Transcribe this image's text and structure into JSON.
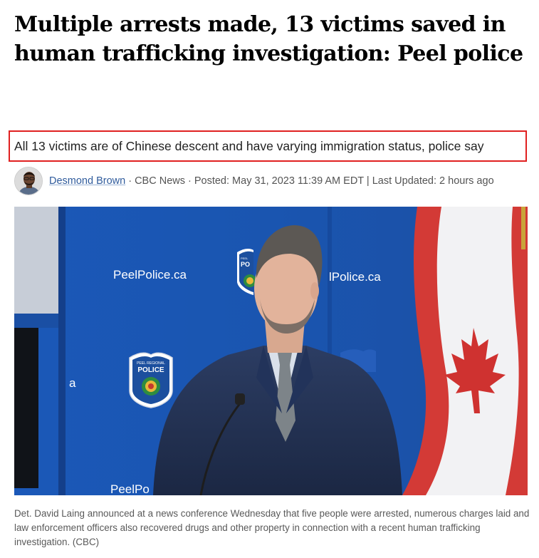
{
  "article": {
    "headline": "Multiple arrests made, 13 victims saved in human trafficking investigation: Peel police",
    "deck": "All 13 victims are of Chinese descent and have varying immigration status, police say",
    "byline": {
      "author": "Desmond Brown",
      "meta": " · CBC News · Posted: May 31, 2023 11:39 AM EDT | Last Updated: 2 hours ago"
    },
    "photo": {
      "backdrop_text_left": "PeelPolice.ca",
      "backdrop_text_right": "lPolice.ca",
      "backdrop_text_bottom": "PeelPo",
      "badge_top": "PEEL REGIONAL",
      "badge_main": "POLICE",
      "badge_small_top": "PEEL",
      "badge_small_main": "PO",
      "edge_letter": "a"
    },
    "caption": "Det. David Laing announced at a news conference Wednesday that five people were arrested, numerous charges laid and law enforcement officers also recovered drugs and other property in connection with a recent human trafficking investigation. (CBC)"
  },
  "colors": {
    "highlight_border": "#e02020",
    "author_link": "#2f5b9c",
    "backdrop_blue": "#1a55b0"
  },
  "icons": [
    "author-avatar",
    "police-badge-icon",
    "canadian-flag"
  ]
}
